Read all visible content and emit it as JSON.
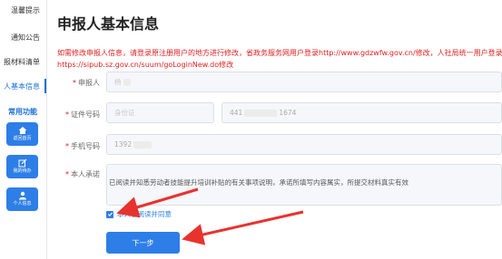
{
  "sidebar": {
    "items": [
      {
        "label": "温馨提示"
      },
      {
        "label": "通知公告"
      },
      {
        "label": "报材料清单"
      },
      {
        "label": "人基本信息"
      }
    ],
    "common_title": "常用功能",
    "buttons": [
      {
        "label": "返回首页",
        "icon": "home-icon"
      },
      {
        "label": "我的待办",
        "icon": "edit-icon"
      },
      {
        "label": "个人信息",
        "icon": "user-icon"
      }
    ]
  },
  "main": {
    "title": "申报人基本信息",
    "notice_line1": "如需修改申报人信息，请登录原注册用户的地方进行修改，省政务服务网用户登录http://www.gdzwfw.gov.cn/修改，人社局统一用户登录",
    "notice_line2": "https://sipub.sz.gov.cn/suum/goLoginNew.do修改",
    "fields": {
      "applicant": {
        "label": "申报人",
        "value": "杨"
      },
      "id_type": {
        "label": "证件号码",
        "value": "身份证"
      },
      "id_number": {
        "prefix": "441",
        "suffix": "1674"
      },
      "phone": {
        "label": "手机号码",
        "value": "1392"
      },
      "commitment": {
        "label": "本人承诺",
        "text": "已阅读并知悉劳动者技能提升培训补贴的有关事项说明，承诺所填写内容属实，所提交材料真实有效"
      }
    },
    "agree_label": "本人已阅读并同意",
    "next_button": "下一步"
  },
  "colors": {
    "accent": "#2e7ee8",
    "notice": "#e02020",
    "arrow": "#e8322e"
  }
}
